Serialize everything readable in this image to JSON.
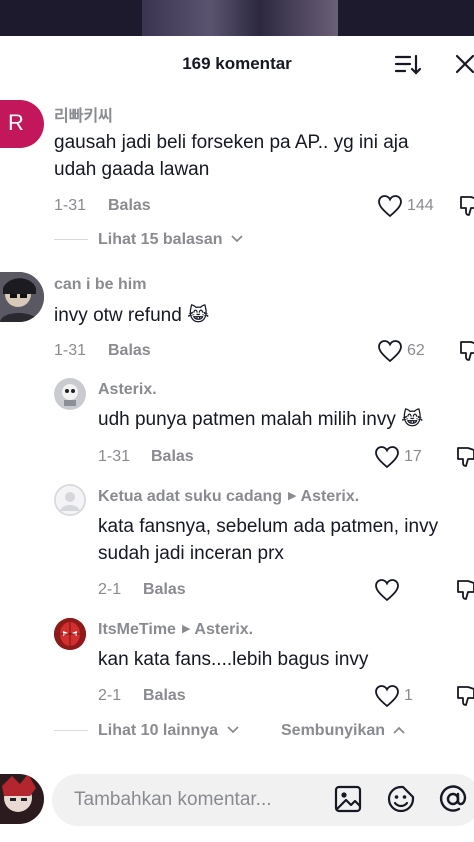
{
  "header": {
    "title": "169 komentar"
  },
  "comments": [
    {
      "username": "리빠키씨",
      "avatar_letter": "R",
      "text_lines": [
        "gausah jadi beli forseken pa AP.. yg ini aja",
        "udah gaada lawan"
      ],
      "date": "1-31",
      "reply_label": "Balas",
      "likes": "144",
      "view_replies": "Lihat 15 balasan"
    },
    {
      "username": "can i be him",
      "text_lines": [
        "invy otw refund 😹"
      ],
      "date": "1-31",
      "reply_label": "Balas",
      "likes": "62",
      "replies": [
        {
          "username": "Asterix.",
          "reply_to": "",
          "text_lines": [
            "udh punya patmen malah milih invy 😹"
          ],
          "date": "1-31",
          "reply_label": "Balas",
          "likes": "17"
        },
        {
          "username": "Ketua adat suku cadang",
          "reply_to": "Asterix.",
          "text_lines": [
            "kata fansnya, sebelum ada patmen, invy",
            "sudah jadi inceran prx"
          ],
          "date": "2-1",
          "reply_label": "Balas",
          "likes": ""
        },
        {
          "username": "ItsMeTime",
          "reply_to": "Asterix.",
          "text_lines": [
            "kan kata fans....lebih bagus invy"
          ],
          "date": "2-1",
          "reply_label": "Balas",
          "likes": "1"
        }
      ],
      "view_more": "Lihat 10 lainnya",
      "hide_label": "Sembunyikan"
    }
  ],
  "footer": {
    "placeholder": "Tambahkan komentar..."
  },
  "colors": {
    "text": "#161823",
    "muted": "#8a8b91",
    "avatar_r": "#c2185b"
  },
  "icons": [
    "sort-icon",
    "close-icon",
    "heart-icon",
    "dislike-icon",
    "chevron-down-icon",
    "chevron-up-icon",
    "image-icon",
    "emoji-icon",
    "mention-icon"
  ]
}
